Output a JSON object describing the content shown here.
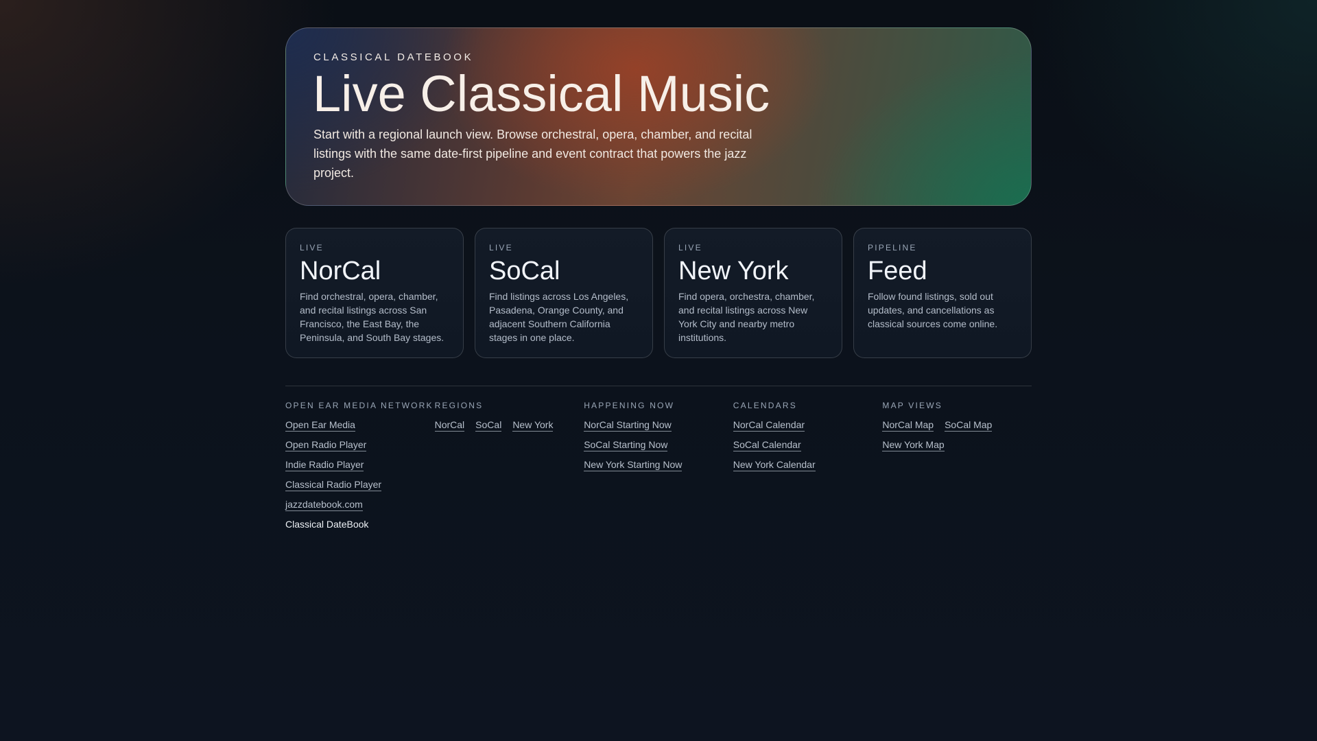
{
  "hero": {
    "eyebrow": "CLASSICAL DATEBOOK",
    "title": "Live Classical Music",
    "description": "Start with a regional launch view. Browse orchestral, opera, chamber, and recital listings with the same date-first pipeline and event contract that powers the jazz project."
  },
  "cards": [
    {
      "tag": "LIVE",
      "title": "NorCal",
      "description": "Find orchestral, opera, chamber, and recital listings across San Francisco, the East Bay, the Peninsula, and South Bay stages."
    },
    {
      "tag": "LIVE",
      "title": "SoCal",
      "description": "Find listings across Los Angeles, Pasadena, Orange County, and adjacent Southern California stages in one place."
    },
    {
      "tag": "LIVE",
      "title": "New York",
      "description": "Find opera, orchestra, chamber, and recital listings across New York City and nearby metro institutions."
    },
    {
      "tag": "PIPELINE",
      "title": "Feed",
      "description": "Follow found listings, sold out updates, and cancellations as classical sources come online."
    }
  ],
  "footer": {
    "network": {
      "heading": "OPEN EAR MEDIA NETWORK",
      "links": [
        "Open Ear Media",
        "Open Radio Player",
        "Indie Radio Player",
        "Classical Radio Player",
        "jazzdatebook.com"
      ],
      "current": "Classical DateBook"
    },
    "regions": {
      "heading": "REGIONS",
      "links": [
        "NorCal",
        "SoCal",
        "New York"
      ]
    },
    "happening": {
      "heading": "HAPPENING NOW",
      "links": [
        "NorCal Starting Now",
        "SoCal Starting Now",
        "New York Starting Now"
      ]
    },
    "calendars": {
      "heading": "CALENDARS",
      "links": [
        "NorCal Calendar",
        "SoCal Calendar",
        "New York Calendar"
      ]
    },
    "maps": {
      "heading": "MAP VIEWS",
      "links": [
        "NorCal Map",
        "SoCal Map",
        "New York Map"
      ]
    }
  }
}
